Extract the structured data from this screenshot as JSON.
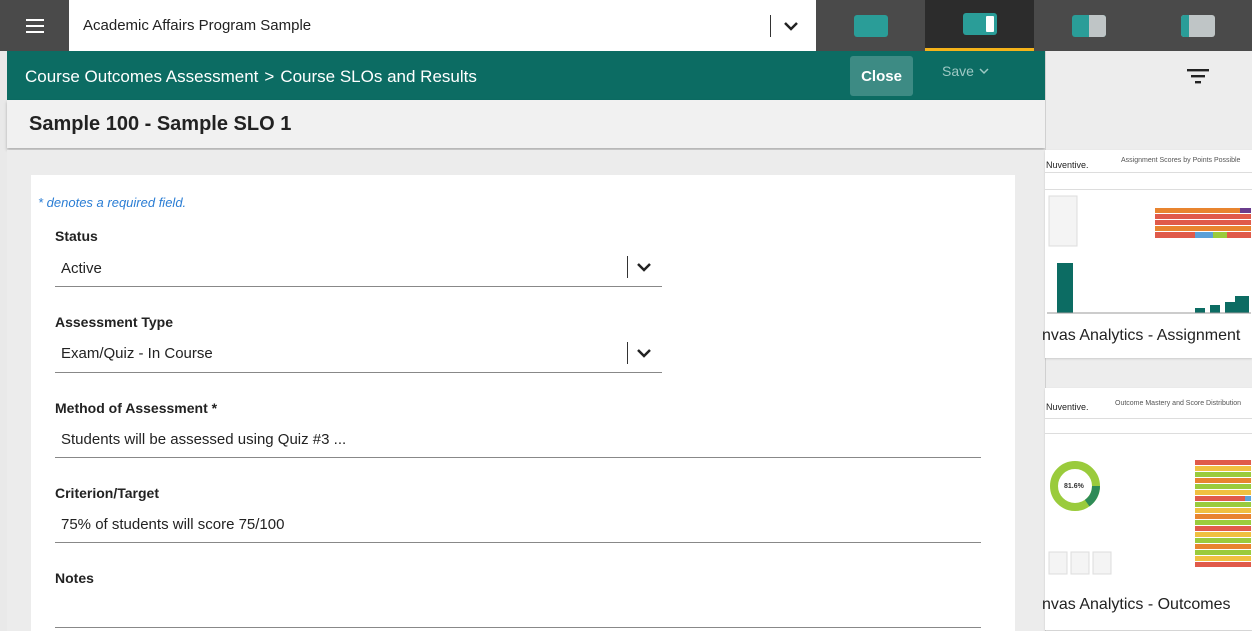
{
  "topbar": {
    "program_name": "Academic Affairs Program Sample",
    "view_buttons": [
      {
        "icon": "full-panel-layout-icon"
      },
      {
        "icon": "wide-split-layout-icon"
      },
      {
        "icon": "half-split-layout-icon"
      },
      {
        "icon": "narrow-split-layout-icon"
      }
    ]
  },
  "header": {
    "breadcrumb_parent": "Course Outcomes Assessment",
    "breadcrumb_separator": ">",
    "breadcrumb_current": "Course SLOs and Results",
    "close_label": "Close",
    "save_label": "Save"
  },
  "page_title": "Sample 100 - Sample SLO 1",
  "form": {
    "required_note": "* denotes a required field.",
    "status": {
      "label": "Status",
      "value": "Active"
    },
    "assessment_type": {
      "label": "Assessment Type",
      "value": "Exam/Quiz - In Course"
    },
    "method": {
      "label": "Method of Assessment *",
      "value": "Students will be assessed using Quiz #3 ..."
    },
    "criterion": {
      "label": "Criterion/Target",
      "value": "75% of students will score 75/100"
    },
    "notes": {
      "label": "Notes",
      "value": ""
    }
  },
  "right_panel": {
    "cards": [
      {
        "brand": "Nuventive.",
        "thumb_title": "Assignment Scores by Points Possible",
        "title": "nvas Analytics - Assignment"
      },
      {
        "brand": "Nuventive.",
        "thumb_title": "Outcome Mastery and Score Distribution",
        "title": "nvas Analytics - Outcomes",
        "donut_label": "81.6%"
      }
    ]
  },
  "colors": {
    "header_green": "#0c6c63",
    "close_button": "#3d8b84",
    "active_tab_underline": "#f5b31a",
    "required_note_blue": "#2a7dd4",
    "teal_icon": "#2a9d98"
  }
}
